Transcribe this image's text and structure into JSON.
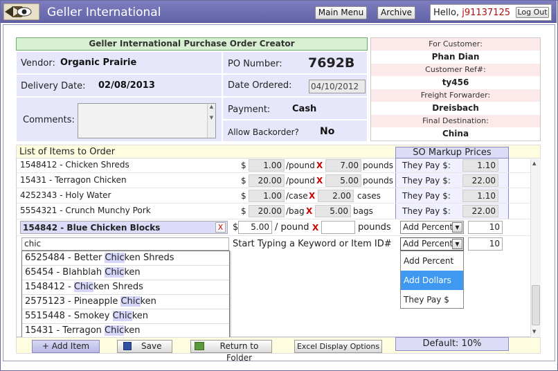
{
  "header": {
    "app_title": "Geller International",
    "main_menu_label": "Main Menu",
    "archive_label": "Archive",
    "hello_prefix": "Hello, ",
    "username": "j91137125",
    "logout_label": "Log Out"
  },
  "form": {
    "title": "Geller International Purchase Order Creator",
    "vendor_label": "Vendor:",
    "vendor_value": "Organic Prairie",
    "po_label": "PO Number:",
    "po_value": "7692B",
    "delivery_label": "Delivery Date:",
    "delivery_value": "02/08/2013",
    "date_ordered_label": "Date Ordered:",
    "date_ordered_value": "04/10/2012",
    "comments_label": "Comments:",
    "payment_label": "Payment:",
    "payment_value": "Cash",
    "backorder_label": "Allow Backorder?",
    "backorder_value": "No"
  },
  "customer_panel": {
    "for_customer_label": "For Customer:",
    "for_customer_value": "Phan Dian",
    "customer_ref_label": "Customer Ref#:",
    "customer_ref_value": "ty456",
    "freight_label": "Freight Forwarder:",
    "freight_value": "Dreisbach",
    "final_dest_label": "Final Destination:",
    "final_dest_value": "China"
  },
  "items": {
    "section_title": "List of Items to Order",
    "markup_header": "SO Markup Prices",
    "currency": "$",
    "they_pay_label": "They Pay $:",
    "rows": [
      {
        "name": "1548412 - Chicken Shreds",
        "price": "1.00",
        "unit": "/pound",
        "qty": "7.00",
        "qty_unit": "pounds",
        "they_pay": "1.10"
      },
      {
        "name": "15431 - Terragon Chicken",
        "price": "20.00",
        "unit": "/pound",
        "qty": "5.00",
        "qty_unit": "pounds",
        "they_pay": "22.00"
      },
      {
        "name": "4252343 - Holy Water",
        "price": "1.00",
        "unit": "/case",
        "qty": "2.00",
        "qty_unit": "cases",
        "they_pay": "1.10"
      },
      {
        "name": "5554321 - Crunch Munchy Pork",
        "price": "20.00",
        "unit": "/bag",
        "qty": "5.00",
        "qty_unit": "bags",
        "they_pay": "22.00"
      }
    ],
    "editing_row": {
      "name": "154842 - Blue Chicken Blocks",
      "remove_label": "X",
      "price": "5.00",
      "unit": "/ pound",
      "qty": "",
      "qty_unit": "pounds",
      "markup_type": "Add Percent",
      "markup_value": "10"
    },
    "search_row": {
      "search_value": "chic",
      "hint": "Start Typing a Keyword or Item ID#",
      "markup_type": "Add Percent",
      "markup_value": "10"
    },
    "suggestions": [
      {
        "pre": "6525484 - Better ",
        "hl": "Chic",
        "post": "ken Shreds"
      },
      {
        "pre": "65454 - Blahblah ",
        "hl": "Chic",
        "post": "ken"
      },
      {
        "pre": "1548412 - ",
        "hl": "Chic",
        "post": "ken Shreds"
      },
      {
        "pre": "2575123 - Pineapple ",
        "hl": "Chic",
        "post": "ken"
      },
      {
        "pre": "5515448 - Smokey ",
        "hl": "Chic",
        "post": "ken"
      },
      {
        "pre": "15431 - Terragon ",
        "hl": "Chic",
        "post": "ken"
      }
    ],
    "markup_options": [
      "Add Percent",
      "Add Dollars",
      "They Pay $"
    ],
    "markup_selected": "Add Dollars"
  },
  "footer": {
    "add_item_label": "+ Add Item",
    "save_label": "Save",
    "return_label": "Return to Folder",
    "excel_label": "Excel Display Options",
    "default_label": "Default: 10%"
  },
  "colors": {
    "topbar": "#6a6ab0",
    "accent_highlight": "#3f99f0",
    "username": "#b01010"
  }
}
